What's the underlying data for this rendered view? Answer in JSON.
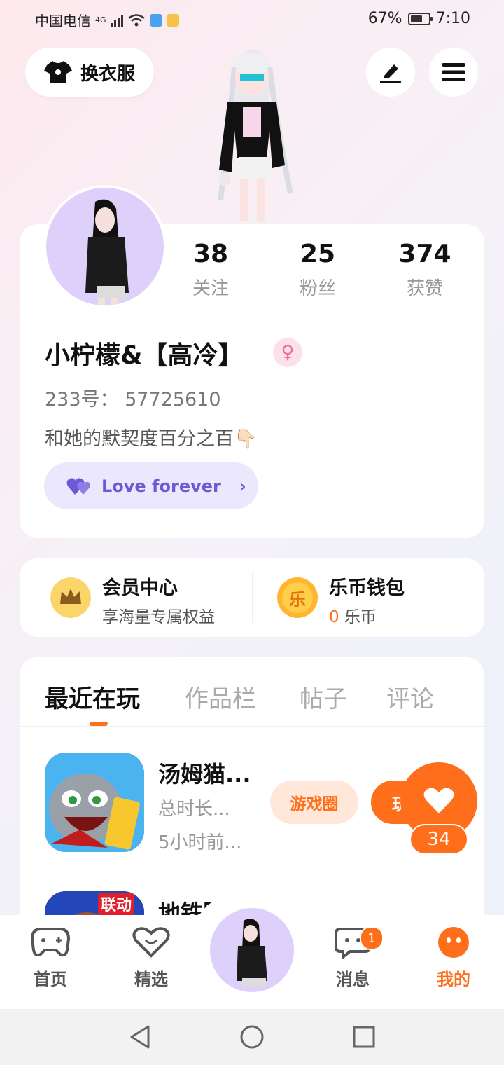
{
  "status_bar": {
    "carrier": "中国电信",
    "network": "4G",
    "battery": "67%",
    "battery_level": 0.67,
    "time": "7:10"
  },
  "header": {
    "outfit_label": "换衣服",
    "icons": [
      "shirt-icon",
      "edit-icon",
      "menu-icon"
    ]
  },
  "profile": {
    "stats": [
      {
        "value": "38",
        "label": "关注"
      },
      {
        "value": "25",
        "label": "粉丝"
      },
      {
        "value": "374",
        "label": "获赞"
      }
    ],
    "name": "小柠檬&【高冷】",
    "gender_symbol": "♀",
    "id_line": "233号：  57725610",
    "bio": "和她的默契度百分之百👇🏻",
    "love_chip": "Love forever"
  },
  "wallet": {
    "member": {
      "title": "会员中心",
      "subtitle": "享海量专属权益"
    },
    "coins": {
      "title": "乐币钱包",
      "amount": "0",
      "unit": "乐币",
      "coin_glyph": "乐"
    }
  },
  "tabs": [
    {
      "label": "最近在玩",
      "active": true
    },
    {
      "label": "作品栏",
      "active": false
    },
    {
      "label": "帖子",
      "active": false
    },
    {
      "label": "评论",
      "active": false
    }
  ],
  "games": [
    {
      "name": "汤姆猫...",
      "duration": "总时长...",
      "last_played": "5小时前...",
      "circle_label": "游戏圈",
      "play_label": "玩"
    },
    {
      "name": "地铁跑",
      "badge": "联动"
    }
  ],
  "like_float": {
    "count": "34"
  },
  "bottom_nav": [
    {
      "label": "首页"
    },
    {
      "label": "精选"
    },
    {
      "label": "消息",
      "badge": "1"
    },
    {
      "label": "我的"
    }
  ],
  "colors": {
    "accent": "#ff6e1b",
    "purple": "#6d59d6",
    "avatar_bg": "#ddd0fb"
  }
}
